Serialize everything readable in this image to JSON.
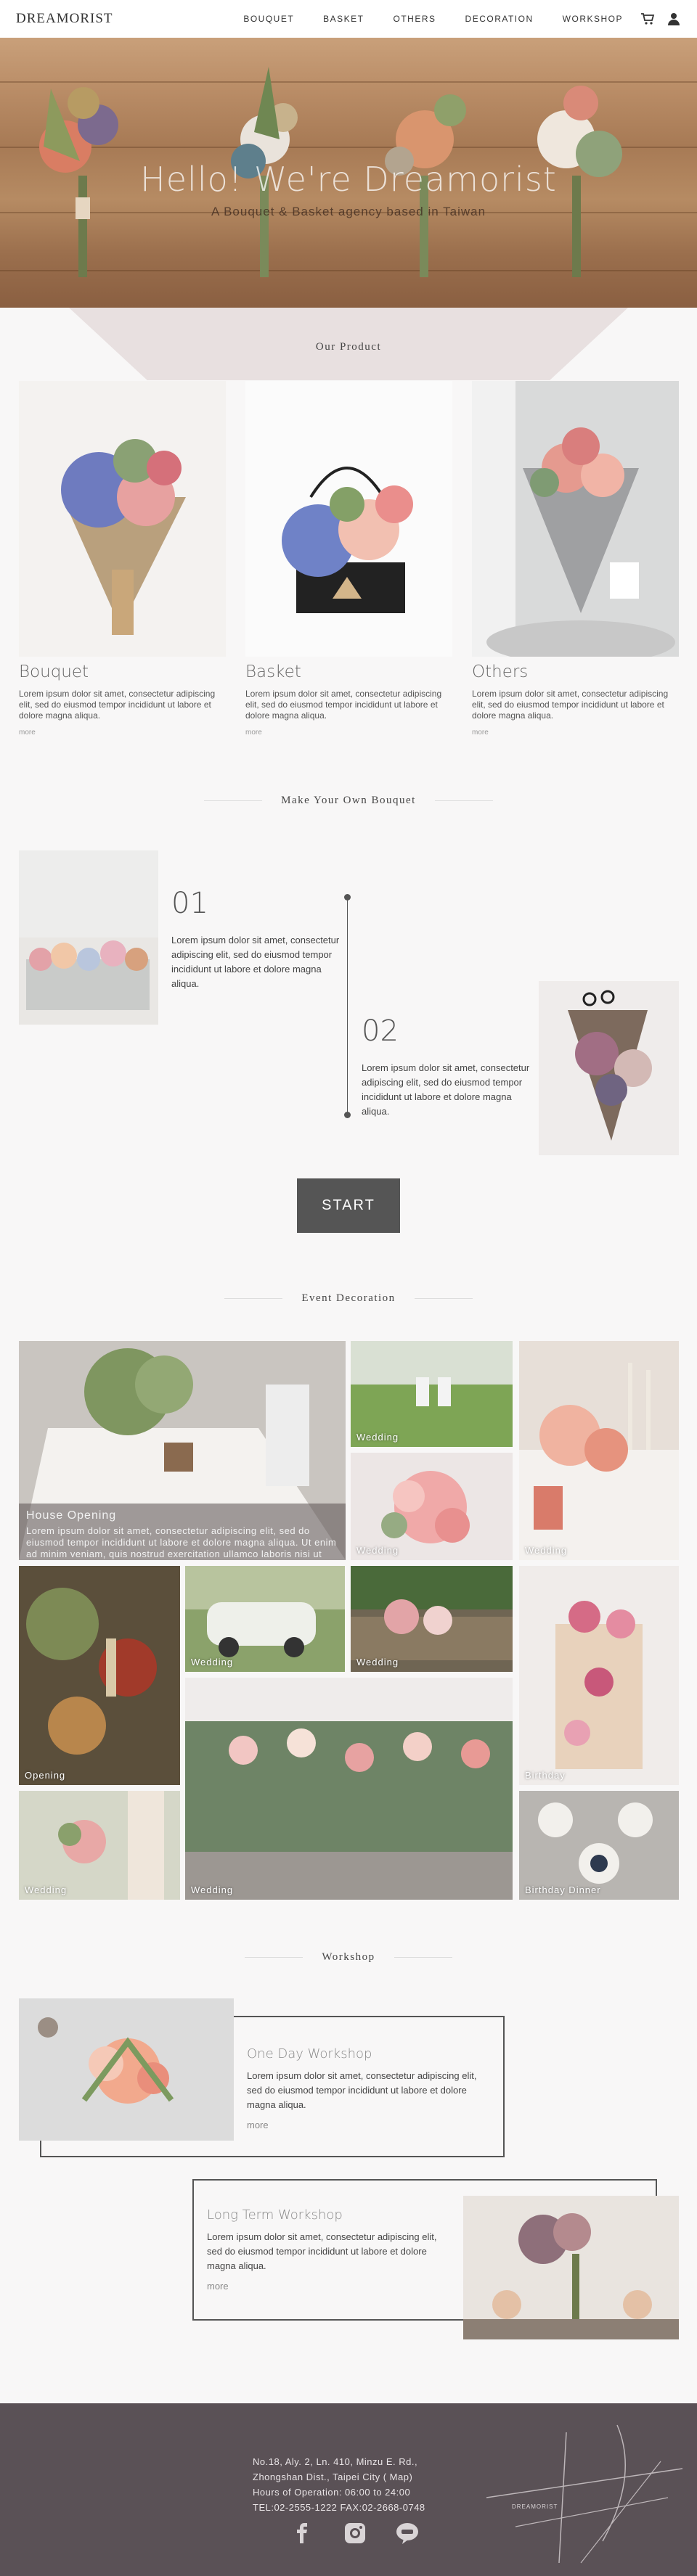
{
  "brand": {
    "logo": "DREAMORIST"
  },
  "nav": {
    "items": [
      "BOUQUET",
      "BASKET",
      "OTHERS",
      "DECORATION",
      "WORKSHOP"
    ]
  },
  "hero": {
    "title": "Hello! We're Dreamorist",
    "subtitle": "A Bouquet & Basket agency based in Taiwan"
  },
  "products": {
    "title": "Our Product",
    "items": [
      {
        "name": "Bouquet",
        "text": "Lorem ipsum dolor sit amet, consectetur adipiscing elit, sed do eiusmod tempor incididunt ut labore et dolore magna aliqua.",
        "more": "more"
      },
      {
        "name": "Basket",
        "text": "Lorem ipsum dolor sit amet, consectetur adipiscing elit, sed do eiusmod tempor incididunt ut labore et dolore magna aliqua.",
        "more": "more"
      },
      {
        "name": "Others",
        "text": "Lorem ipsum dolor sit amet, consectetur adipiscing elit, sed do eiusmod tempor incididunt ut labore et dolore magna aliqua.",
        "more": "more"
      }
    ]
  },
  "make": {
    "title": "Make Your Own Bouquet",
    "steps": [
      {
        "num": "01",
        "text": "Lorem ipsum dolor sit amet, consectetur adipiscing elit, sed do eiusmod tempor incididunt ut labore et dolore magna aliqua."
      },
      {
        "num": "02",
        "text": "Lorem ipsum dolor sit amet, consectetur adipiscing elit, sed do eiusmod tempor incididunt ut labore et dolore magna aliqua."
      }
    ],
    "start": "START"
  },
  "events": {
    "title": "Event Decoration",
    "featured": {
      "title": "House Opening",
      "desc": "Lorem ipsum dolor sit amet, consectetur adipiscing elit, sed do eiusmod tempor incididunt ut labore et dolore magna aliqua. Ut enim ad minim veniam, quis nostrud exercitation ullamco laboris nisi ut aliquip ex ea commodo consequat."
    },
    "captions": [
      "Wedding",
      "Wedding",
      "Wedding",
      "Wedding",
      "Wedding",
      "Opening",
      "Birthday",
      "Wedding",
      "Wedding",
      "Birthday Dinner"
    ]
  },
  "workshop": {
    "title": "Workshop",
    "items": [
      {
        "title": "One Day Workshop",
        "text": "Lorem ipsum dolor sit amet, consectetur adipiscing elit, sed do eiusmod tempor incididunt ut labore et dolore magna aliqua.",
        "more": "more"
      },
      {
        "title": "Long Term Workshop",
        "text": "Lorem ipsum dolor sit amet, consectetur adipiscing elit, sed do eiusmod tempor incididunt ut labore et dolore magna aliqua.",
        "more": "more"
      }
    ]
  },
  "footer": {
    "lines": [
      "No.18, Aly. 2, Ln. 410, Minzu E. Rd.,",
      "Zhongshan Dist., Taipei City ( Map)",
      "Hours of Operation: 06:00 to 24:00",
      "TEL:02-2555-1222 FAX:02-2668-0748"
    ],
    "mark_text": "DREAMORIST"
  },
  "icons": {
    "cart": "cart-icon",
    "user": "user-icon",
    "facebook": "facebook-icon",
    "instagram": "instagram-icon",
    "line": "line-icon"
  }
}
